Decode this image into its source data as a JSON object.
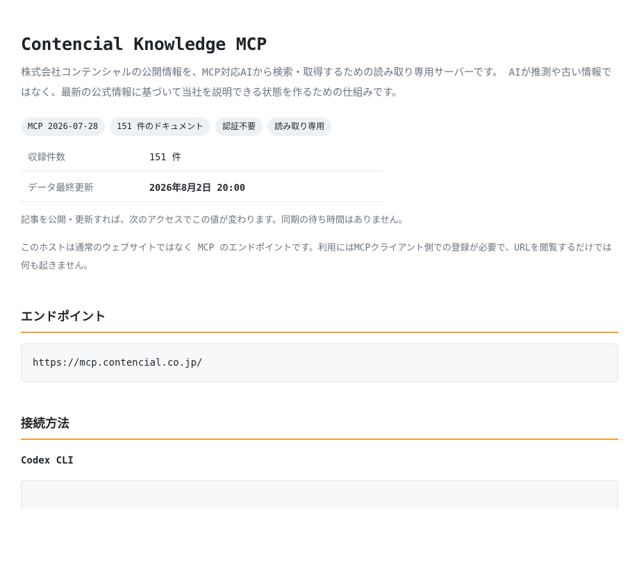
{
  "header": {
    "title": "Contencial Knowledge MCP",
    "lead": "株式会社コンテンシャルの公開情報を、MCP対応AIから検索・取得するための読み取り専用サーバーです。 AIが推測や古い情報ではなく、最新の公式情報に基づいて当社を説明できる状態を作るための仕組みです。"
  },
  "badges": [
    "MCP 2026-07-28",
    "151 件のドキュメント",
    "認証不要",
    "読み取り専用"
  ],
  "stats": [
    {
      "label": "収録件数",
      "value": "151 件"
    },
    {
      "label": "データ最終更新",
      "value": "2026年8月2日 20:00"
    }
  ],
  "notes": {
    "update": "記事を公開・更新すれば、次のアクセスでこの値が変わります。同期の待ち時間はありません。",
    "host": "このホストは通常のウェブサイトではなく MCP のエンドポイントです。利用にはMCPクライアント側での登録が必要で、URLを閲覧するだけでは何も起きません。"
  },
  "endpoint": {
    "heading": "エンドポイント",
    "url": "https://mcp.contencial.co.jp/"
  },
  "connect": {
    "heading": "接続方法",
    "client": "Codex CLI"
  },
  "colors": {
    "accent": "#f0a030",
    "muted_text": "#6a737d",
    "badge_bg": "#eef1f4",
    "code_bg": "#f6f8fa"
  }
}
